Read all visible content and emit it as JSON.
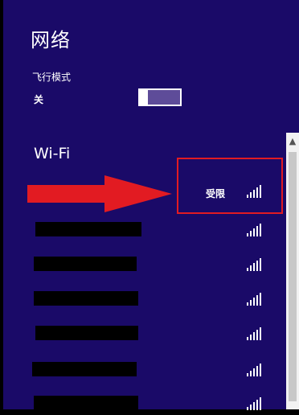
{
  "panel": {
    "title": "网络"
  },
  "airplane_mode": {
    "label": "飞行模式",
    "state": "关",
    "on": false
  },
  "wifi": {
    "heading": "Wi-Fi",
    "networks": [
      {
        "name": "",
        "status": "受限",
        "highlighted": true
      },
      {
        "name": "",
        "status": ""
      },
      {
        "name": "",
        "status": ""
      },
      {
        "name": "",
        "status": ""
      },
      {
        "name": "",
        "status": ""
      },
      {
        "name": "",
        "status": ""
      },
      {
        "name": "",
        "status": ""
      }
    ]
  },
  "colors": {
    "panel_background": "#1a0a68",
    "annotation_red": "#e21b22",
    "redaction": "#000000"
  }
}
